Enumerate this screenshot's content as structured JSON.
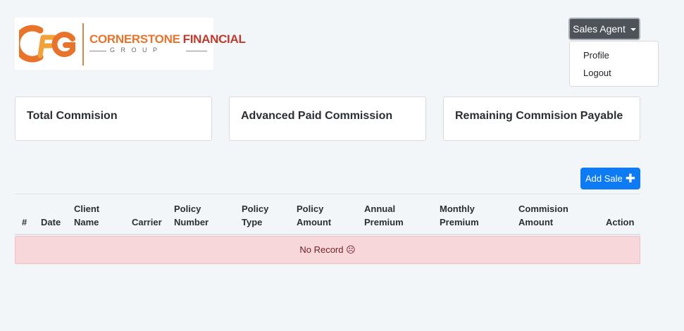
{
  "logo": {
    "mark_text": "CFG",
    "name_word1": "CORNERSTONE",
    "name_word2": "FINANCIAL",
    "tagline": "GROUP"
  },
  "user_menu": {
    "label": "Sales Agent",
    "items": [
      "Profile",
      "Logout"
    ]
  },
  "cards": [
    {
      "title": "Total Commision"
    },
    {
      "title": "Advanced Paid Commission"
    },
    {
      "title": "Remaining Commision Payable"
    }
  ],
  "add_sale": {
    "label": "Add Sale",
    "icon": "plus-icon"
  },
  "table": {
    "columns": [
      {
        "line1": "",
        "line2": "#"
      },
      {
        "line1": "",
        "line2": "Date"
      },
      {
        "line1": "Client",
        "line2": "Name"
      },
      {
        "line1": "",
        "line2": "Carrier"
      },
      {
        "line1": "Policy",
        "line2": "Number"
      },
      {
        "line1": "Policy",
        "line2": "Type"
      },
      {
        "line1": "Policy",
        "line2": "Amount"
      },
      {
        "line1": "Annual",
        "line2": "Premium"
      },
      {
        "line1": "Monthly",
        "line2": "Premium"
      },
      {
        "line1": "Commision",
        "line2": "Amount"
      },
      {
        "line1": "",
        "line2": "Action"
      }
    ],
    "empty_message": "No Record ☹"
  },
  "colors": {
    "background": "#f3f6f9",
    "primary": "#0d7bf4",
    "dropdown": "#4d5358",
    "empty_row": "#f8d7da",
    "logo_orange": "#e8742c",
    "logo_red": "#c0392b"
  }
}
